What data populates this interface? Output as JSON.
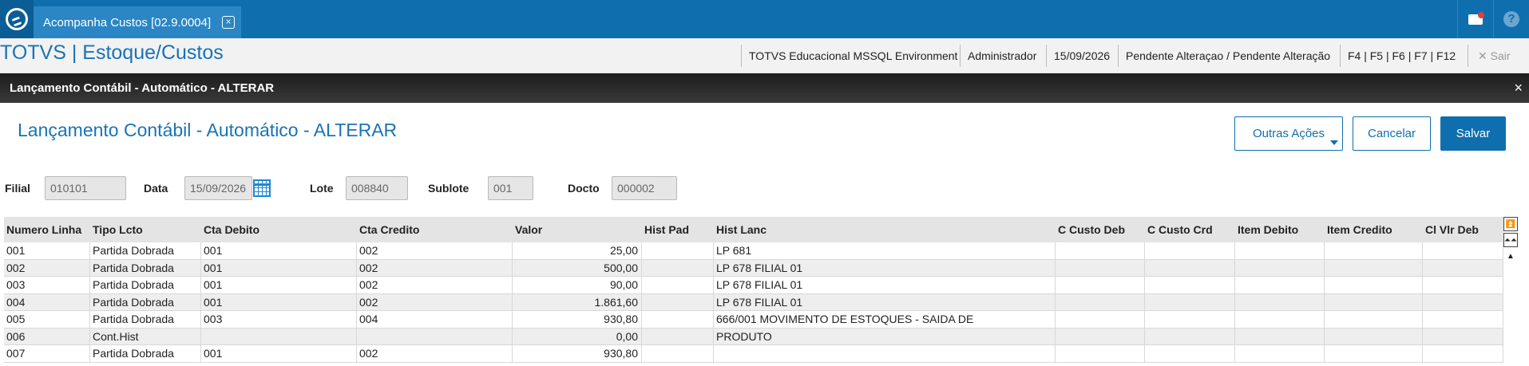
{
  "topbar": {
    "tab_title": "Acompanha Custos [02.9.0004]",
    "tab_close": "×"
  },
  "subbar": {
    "app_title": "TOTVS | Estoque/Custos",
    "environment": "TOTVS Educacional MSSQL Environment",
    "user": "Administrador",
    "date": "15/09/2026",
    "status": "Pendente Alteraçao / Pendente Alteração",
    "shortcuts": "F4 | F5 | F6 | F7 | F12",
    "exit_icon": "✕",
    "exit_label": "Sair"
  },
  "window": {
    "title": "Lançamento Contábil - Automático - ALTERAR",
    "close": "×"
  },
  "page": {
    "title": "Lançamento Contábil - Automático - ALTERAR"
  },
  "actions": {
    "more": "Outras Ações",
    "cancel": "Cancelar",
    "save": "Salvar"
  },
  "fields": {
    "filial_label": "Filial",
    "filial_value": "010101",
    "data_label": "Data",
    "data_value": "15/09/2026",
    "lote_label": "Lote",
    "lote_value": "008840",
    "sublote_label": "Sublote",
    "sublote_value": "001",
    "docto_label": "Docto",
    "docto_value": "000002"
  },
  "grid": {
    "columns": [
      "Numero Linha",
      "Tipo Lcto",
      "Cta Debito",
      "Cta Credito",
      "Valor",
      "Hist Pad",
      "Hist Lanc",
      "C Custo Deb",
      "C Custo Crd",
      "Item Debito",
      "Item Credito",
      "Cl Vlr Deb"
    ],
    "rows": [
      [
        "001",
        "Partida Dobrada",
        "001",
        "002",
        "25,00",
        "",
        "LP 681",
        "",
        "",
        "",
        "",
        ""
      ],
      [
        "002",
        "Partida Dobrada",
        "001",
        "002",
        "500,00",
        "",
        "LP 678 FILIAL 01",
        "",
        "",
        "",
        "",
        ""
      ],
      [
        "003",
        "Partida Dobrada",
        "001",
        "002",
        "90,00",
        "",
        "LP 678 FILIAL 01",
        "",
        "",
        "",
        "",
        ""
      ],
      [
        "004",
        "Partida Dobrada",
        "001",
        "002",
        "1.861,60",
        "",
        "LP 678 FILIAL 01",
        "",
        "",
        "",
        "",
        ""
      ],
      [
        "005",
        "Partida Dobrada",
        "003",
        "004",
        "930,80",
        "",
        "666/001 MOVIMENTO DE ESTOQUES - SAIDA DE",
        "",
        "",
        "",
        "",
        ""
      ],
      [
        "006",
        "Cont.Hist",
        "",
        "",
        "0,00",
        "",
        "PRODUTO",
        "",
        "",
        "",
        "",
        ""
      ],
      [
        "007",
        "Partida Dobrada",
        "001",
        "002",
        "930,80",
        "",
        "",
        "",
        "",
        "",
        "",
        ""
      ]
    ]
  },
  "scroll": {
    "top": "⏫",
    "page_up": "⏶⏶",
    "up": "▲"
  }
}
